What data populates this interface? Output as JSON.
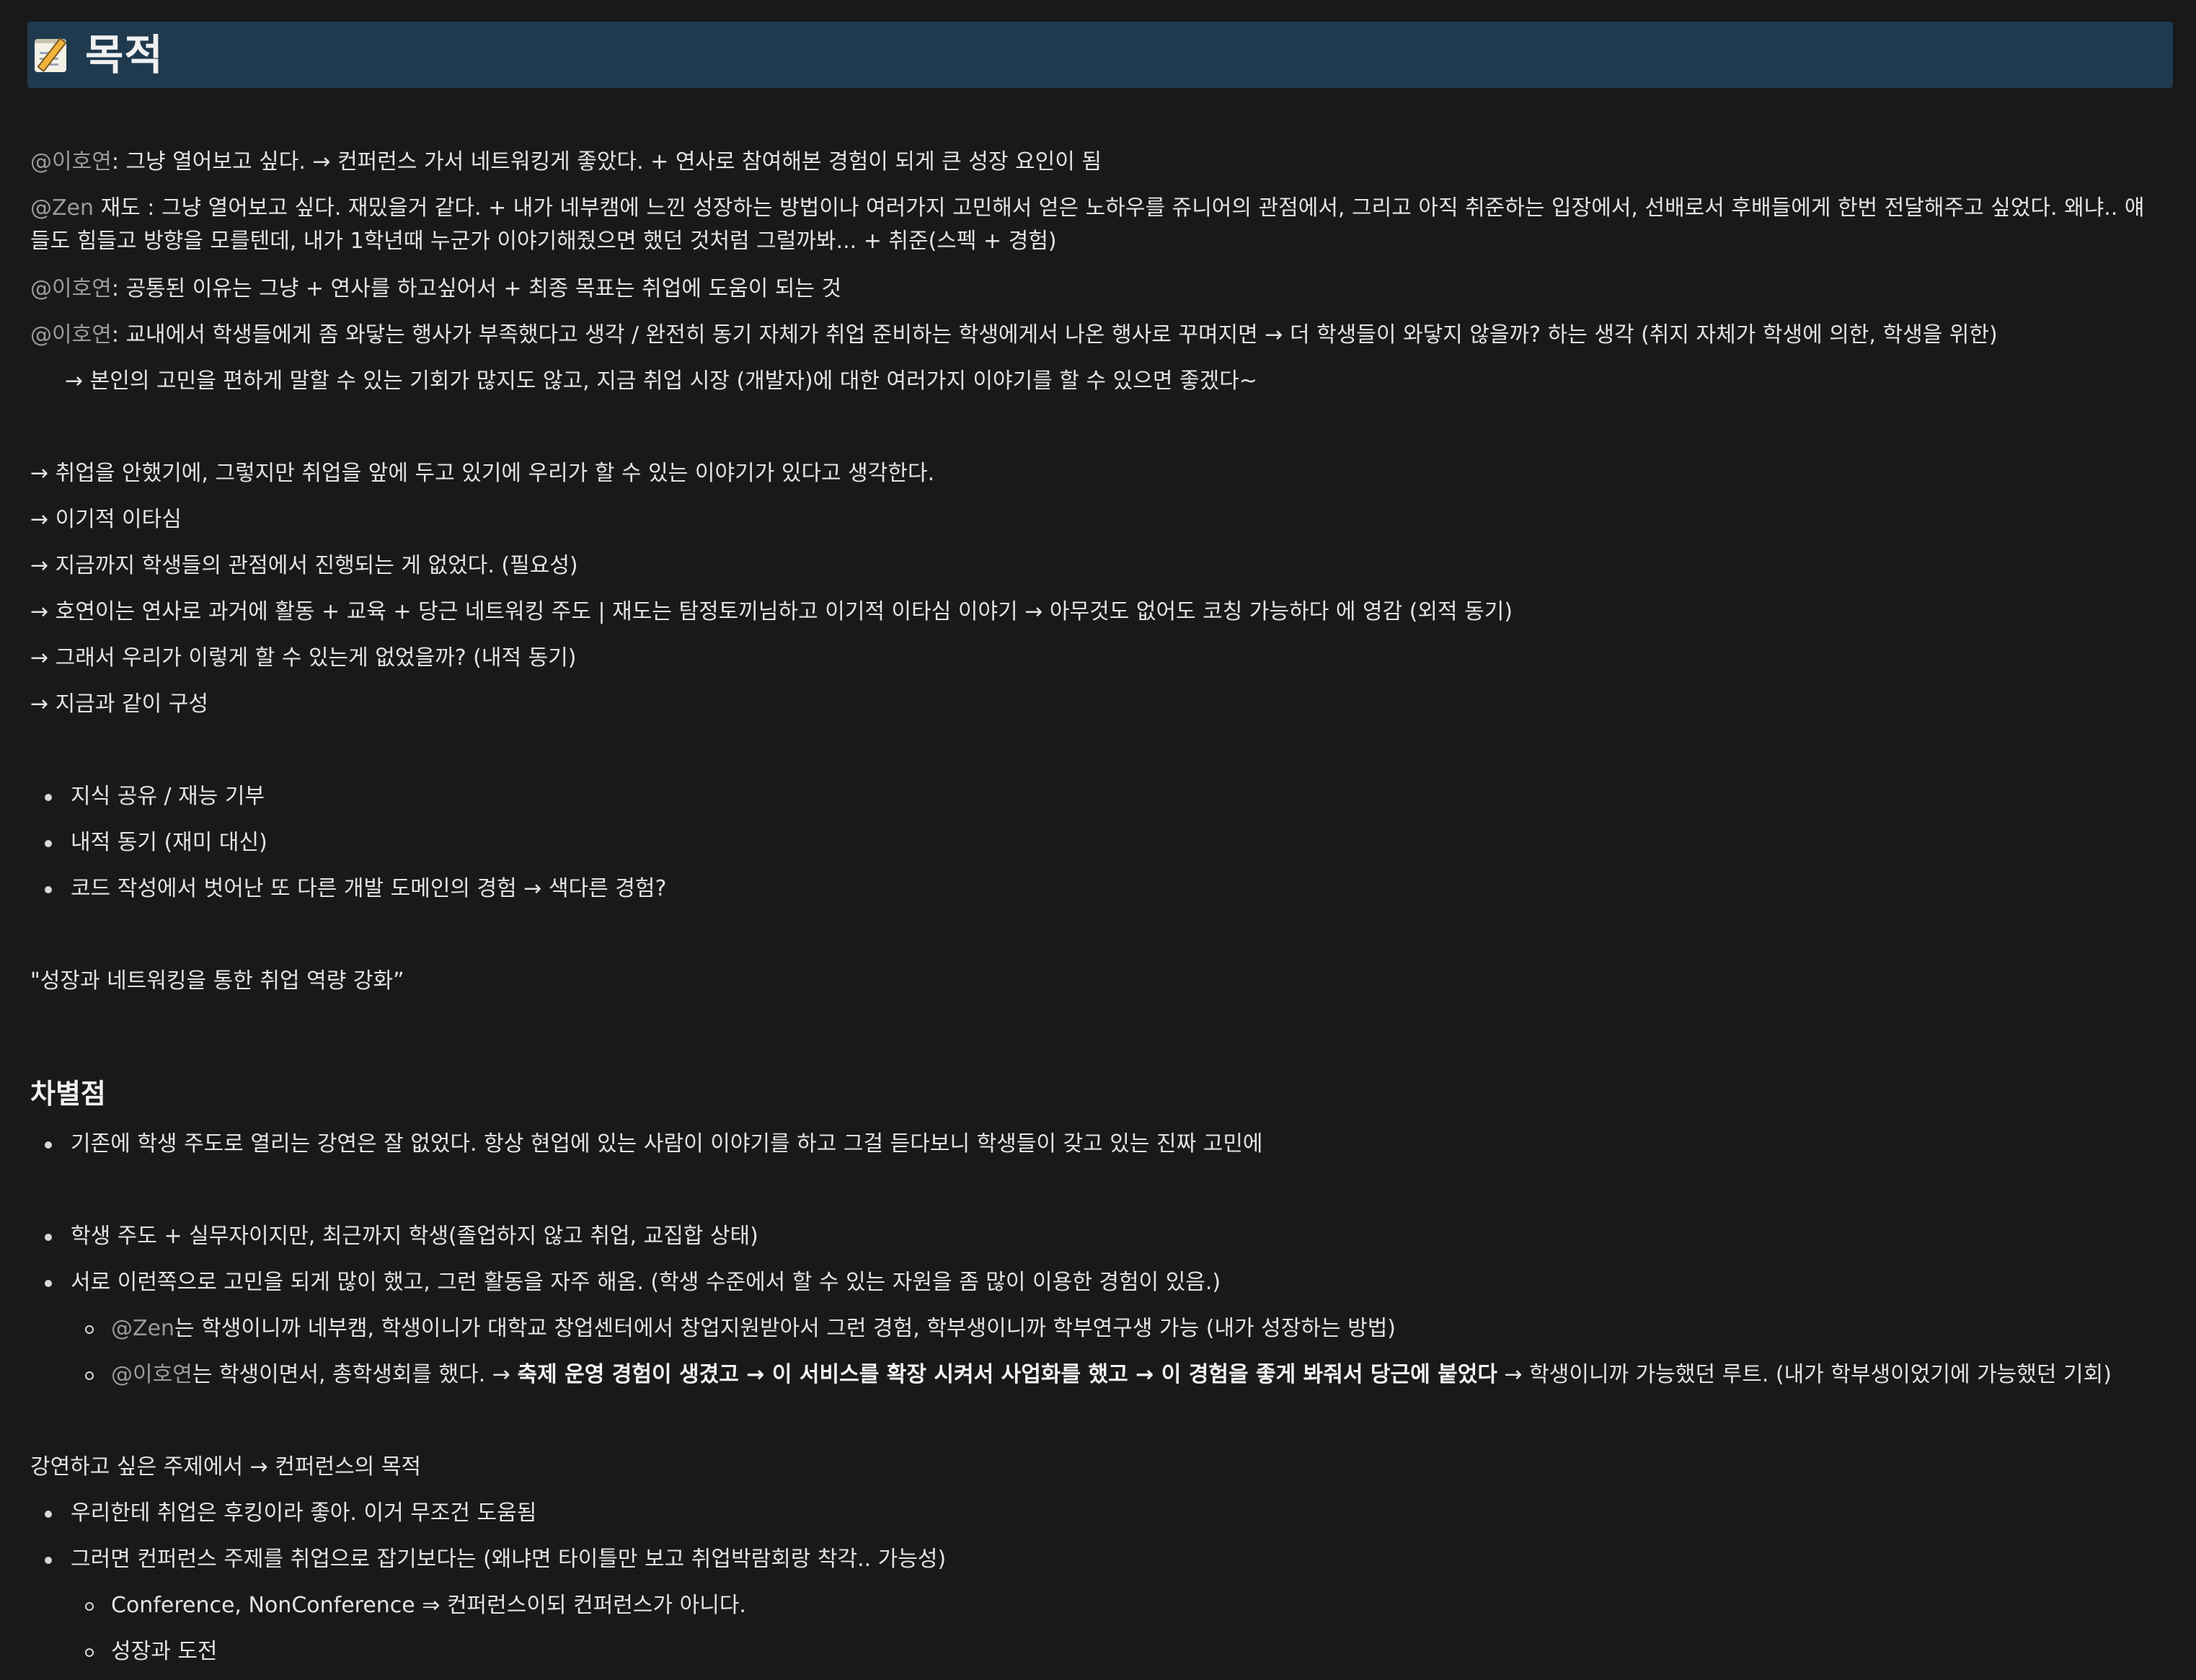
{
  "header": {
    "emoji": "memo-icon",
    "title": "목적"
  },
  "intro": {
    "l1": {
      "mention": "@이호연",
      "text": ": 그냥 열어보고 싶다. → 컨퍼런스 가서 네트워킹게 좋았다. + 연사로 참여해본 경험이 되게 큰 성장 요인이 됨"
    },
    "l2": {
      "mention": "@Zen",
      "text": " 재도 : 그냥 열어보고 싶다. 재밌을거 같다. + 내가 네부캠에 느낀 성장하는 방법이나 여러가지 고민해서 얻은 노하우를 쥬니어의 관점에서, 그리고 아직 취준하는 입장에서, 선배로서 후배들에게 한번 전달해주고 싶었다. 왜냐.. 얘들도 힘들고 방향을 모를텐데, 내가 1학년때 누군가 이야기해줬으면 했던 것처럼 그럴까봐... + 취준(스펙 + 경험)"
    },
    "l3": {
      "mention": "@이호연",
      "text": ": 공통된 이유는 그냥 + 연사를 하고싶어서 + 최종 목표는 취업에 도움이 되는 것"
    },
    "l4": {
      "mention": "@이호연",
      "text": ": 교내에서 학생들에게 좀 와닿는 행사가 부족했다고 생각 / 완전히 동기 자체가 취업 준비하는 학생에게서 나온 행사로 꾸며지면 → 더 학생들이 와닿지 않을까? 하는 생각 (취지 자체가 학생에 의한, 학생을 위한)"
    },
    "l5": "→ 본인의 고민을 편하게 말할 수 있는 기회가 많지도 않고, 지금 취업 시장 (개발자)에 대한 여러가지 이야기를 할 수 있으면 좋겠다~"
  },
  "arrows": [
    "→ 취업을 안했기에, 그렇지만 취업을 앞에 두고 있기에 우리가 할 수 있는 이야기가 있다고 생각한다.",
    "→ 이기적 이타심",
    "→ 지금까지 학생들의 관점에서 진행되는 게 없었다. (필요성)",
    "→ 호연이는 연사로 과거에 활동 + 교육 + 당근 네트워킹 주도 | 재도는 탐정토끼님하고 이기적 이타심 이야기 → 아무것도 없어도 코칭 가능하다 에 영감 (외적 동기)",
    "→ 그래서 우리가 이렇게 할 수 있는게 없었을까? (내적 동기)",
    "→ 지금과 같이 구성"
  ],
  "bullets1": [
    "지식 공유 / 재능 기부",
    "내적 동기 (재미 대신)",
    "코드 작성에서 벗어난 또 다른 개발 도메인의 경험 → 색다른 경험?"
  ],
  "quote": "\"성장과 네트워킹을 통한 취업 역량 강화”",
  "diff": {
    "heading": "차별점",
    "b1": "기존에 학생 주도로 열리는 강연은 잘 없었다. 항상 현업에 있는 사람이 이야기를 하고 그걸 듣다보니 학생들이 갖고 있는 진짜 고민에",
    "b2": "학생 주도 + 실무자이지만, 최근까지 학생(졸업하지 않고 취업, 교집합 상태)",
    "b3": "서로 이런쪽으로 고민을 되게 많이 했고, 그런 활동을 자주 해옴. (학생 수준에서 할 수 있는 자원을 좀 많이 이용한 경험이 있음.)",
    "s1": {
      "mention": "@Zen",
      "text": "는 학생이니까 네부캠, 학생이니가 대학교 창업센터에서 창업지원받아서 그런 경험, 학부생이니까 학부연구생 가능 (내가 성장하는 방법)"
    },
    "s2": {
      "mention": "@이호연",
      "pre": "는 학생이면서, 총학생회를 했다. → ",
      "bold": "축제 운영 경험이 생겼고 → 이 서비스를 확장 시켜서 사업화를 했고 → 이 경험을 좋게 봐줘서 당근에 붙었다",
      "post": " → 학생이니까 가능했던 루트. (내가 학부생이었기에 가능했던 기회)"
    }
  },
  "topic": {
    "line": "강연하고 싶은 주제에서 → 컨퍼런스의 목적",
    "b1": "우리한테 취업은 후킹이라 좋아. 이거 무조건 도움됨",
    "b2": "그러면 컨퍼런스 주제를 취업으로 잡기보다는 (왜냐면 타이틀만 보고 취업박람회랑 착각.. 가능성)",
    "s1": "Conference, NonConference ⇒ 컨퍼런스이되 컨퍼런스가 아니다.",
    "s2": "성장과 도전"
  }
}
